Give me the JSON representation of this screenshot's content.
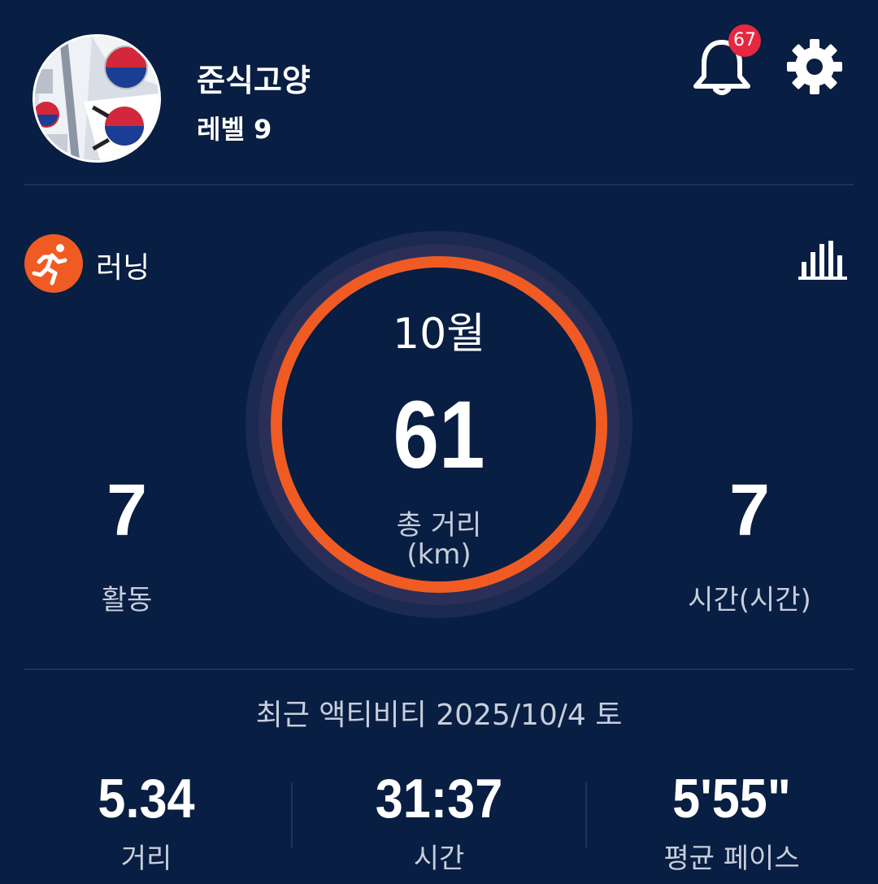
{
  "profile": {
    "username": "준식고양",
    "level": "레벨 9",
    "avatar": "korean-flag-photo"
  },
  "header": {
    "notification_icon": "bell-icon",
    "notification_count": "67",
    "settings_icon": "gear-icon"
  },
  "activity": {
    "type_label": "러닝",
    "type_icon": "running-person-icon",
    "stats_icon": "bar-chart-icon"
  },
  "summary": {
    "month": "10월",
    "total_distance": "61",
    "total_distance_label": "총 거리",
    "total_distance_unit": "(km)",
    "activities_value": "7",
    "activities_label": "활동",
    "hours_value": "7",
    "hours_label": "시간(시간)"
  },
  "recent": {
    "title": "최근 액티비티 2025/10/4 토",
    "distance_value": "5.34",
    "distance_label": "거리",
    "time_value": "31:37",
    "time_label": "시간",
    "pace_value": "5'55\"",
    "pace_label": "평균 페이스"
  },
  "colors": {
    "background": "#081e42",
    "accent": "#f05b23",
    "badge": "#e5283f",
    "muted_text": "#c7cedb"
  }
}
